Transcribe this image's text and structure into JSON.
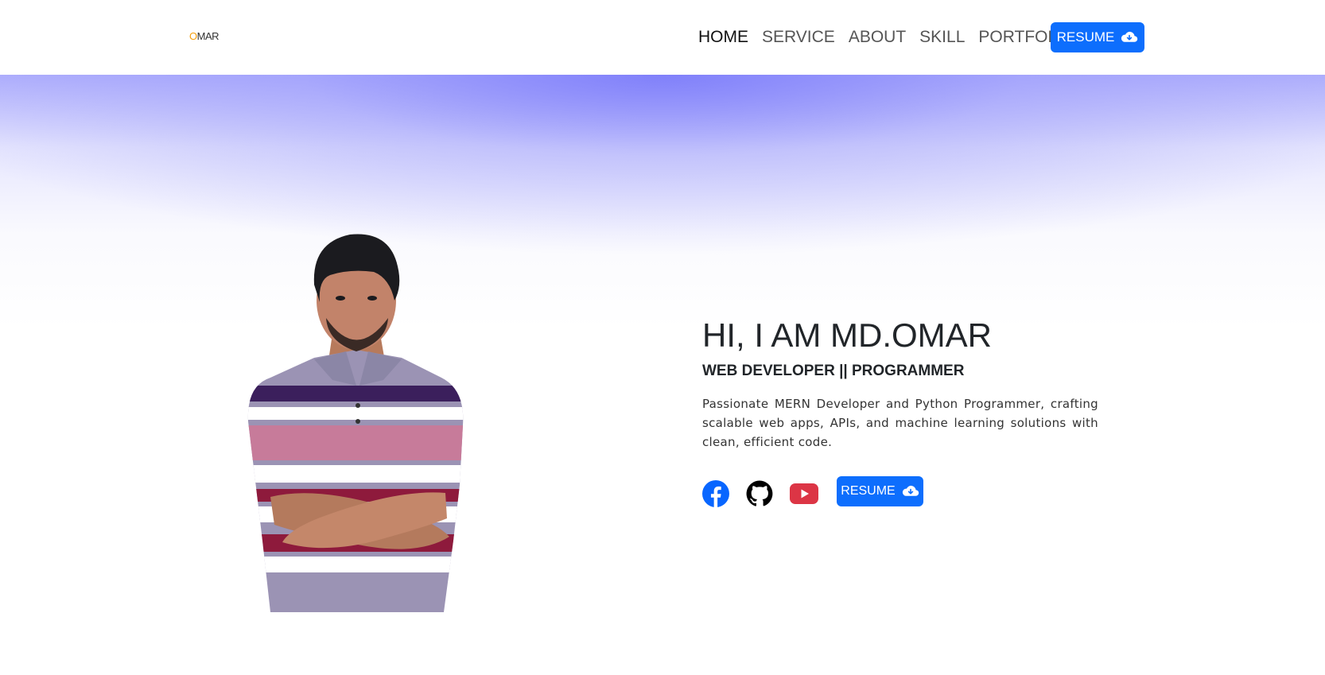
{
  "brand": {
    "logo_o": "O",
    "logo_rest": "MAR"
  },
  "nav": {
    "links": [
      {
        "label": "HOME",
        "active": true
      },
      {
        "label": "SERVICE",
        "active": false
      },
      {
        "label": "ABOUT",
        "active": false
      },
      {
        "label": "SKILL",
        "active": false
      },
      {
        "label": "PORTFOLIO",
        "active": false
      }
    ],
    "resume_label": "RESUME",
    "resume_icon": "cloud-download-icon"
  },
  "hero": {
    "title": "HI, I AM MD.OMAR",
    "subtitle": "WEB DEVELOPER || PROGRAMMER",
    "description": "Passionate MERN Developer and Python Programmer, crafting scalable web apps, APIs, and machine learning solutions with clean, efficient code.",
    "socials": [
      {
        "icon": "facebook-icon",
        "color": "#0866ff"
      },
      {
        "icon": "github-icon",
        "color": "#000000"
      },
      {
        "icon": "youtube-icon",
        "color": "#dc3545"
      }
    ],
    "resume_label": "RESUME",
    "resume_icon": "cloud-download-icon"
  },
  "colors": {
    "accent": "#0d6efd",
    "logo_accent": "#f59e0b",
    "hero_gradient": "#8f8ffa"
  }
}
